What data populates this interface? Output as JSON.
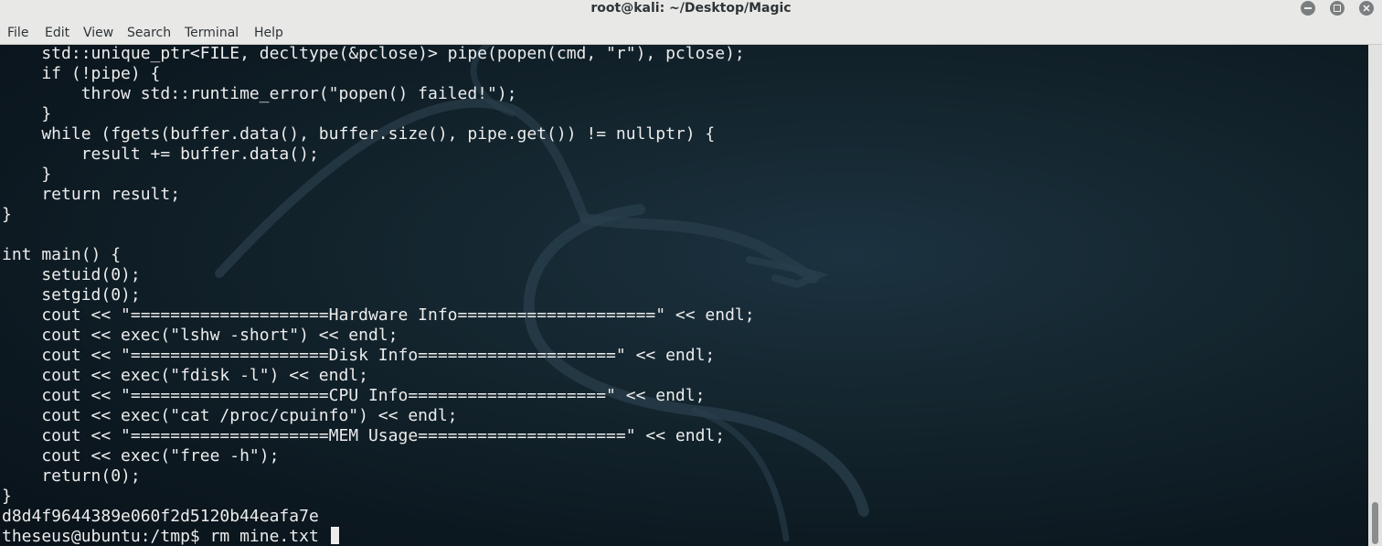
{
  "window": {
    "title": "root@kali: ~/Desktop/Magic"
  },
  "menubar": {
    "items": [
      "File",
      "Edit",
      "View",
      "Search",
      "Terminal",
      "Help"
    ]
  },
  "terminal": {
    "lines": [
      "    std::unique_ptr<FILE, decltype(&pclose)> pipe(popen(cmd, \"r\"), pclose);",
      "    if (!pipe) {",
      "        throw std::runtime_error(\"popen() failed!\");",
      "    }",
      "    while (fgets(buffer.data(), buffer.size(), pipe.get()) != nullptr) {",
      "        result += buffer.data();",
      "    }",
      "    return result;",
      "}",
      "",
      "int main() {",
      "    setuid(0);",
      "    setgid(0);",
      "    cout << \"====================Hardware Info====================\" << endl;",
      "    cout << exec(\"lshw -short\") << endl;",
      "    cout << \"====================Disk Info====================\" << endl;",
      "    cout << exec(\"fdisk -l\") << endl;",
      "    cout << \"====================CPU Info====================\" << endl;",
      "    cout << exec(\"cat /proc/cpuinfo\") << endl;",
      "    cout << \"====================MEM Usage=====================\" << endl;",
      "    cout << exec(\"free -h\");",
      "    return(0);",
      "}",
      "d8d4f9644389e060f2d5120b44eafa7e"
    ],
    "prompt": "theseus@ubuntu:/tmp$ ",
    "command": "rm mine.txt "
  },
  "colors": {
    "background": "#0e1c26",
    "text": "#ececec",
    "chrome": "#e8e8e7"
  },
  "icons": [
    "minimize-icon",
    "maximize-icon",
    "close-icon",
    "kali-dragon-logo"
  ]
}
